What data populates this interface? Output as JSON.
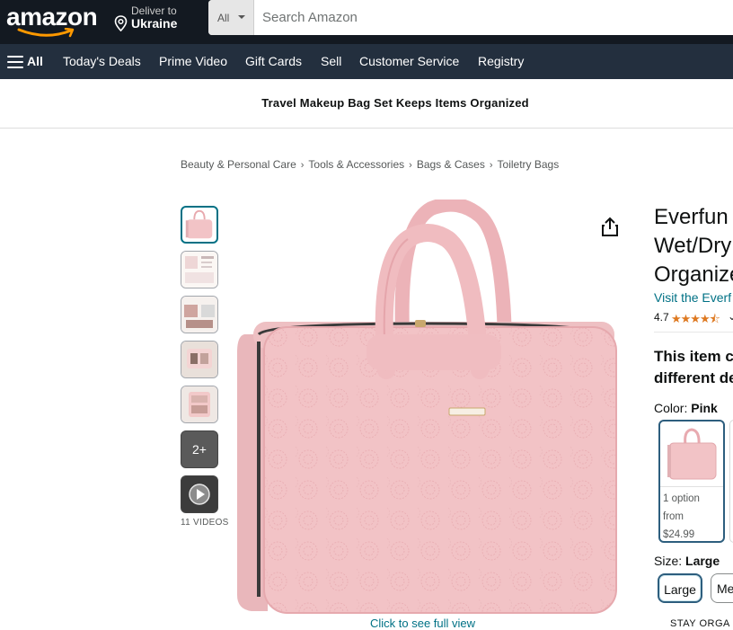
{
  "header": {
    "logo_text": "amazon",
    "deliver_line1": "Deliver to",
    "deliver_line2": "Ukraine",
    "search_category": "All",
    "search_placeholder": "Search Amazon"
  },
  "nav": {
    "all_label": "All",
    "items": [
      "Today's Deals",
      "Prime Video",
      "Gift Cards",
      "Sell",
      "Customer Service",
      "Registry"
    ]
  },
  "promo": {
    "text": "Travel Makeup Bag Set Keeps Items Organized"
  },
  "breadcrumb": [
    "Beauty & Personal Care",
    "Tools & Accessories",
    "Bags & Cases",
    "Toiletry Bags"
  ],
  "gallery": {
    "more_count": "2+",
    "videos_label": "11 VIDEOS",
    "full_view_link": "Click to see full view"
  },
  "product": {
    "title_lines": [
      "Everfun",
      "Wet/Dry",
      "Organize"
    ],
    "store_link": "Visit the Everf",
    "rating_value": "4.7",
    "rating_stars": 4.7,
    "notice_lines": [
      "This item c",
      "different de"
    ],
    "color_label": "Color:",
    "color_value": "Pink",
    "swatch_text_1": "1 option",
    "swatch_text_2": "from",
    "swatch_price": "$24.99",
    "size_label": "Size:",
    "size_value": "Large",
    "size_options": [
      "Large",
      "Me"
    ],
    "partial_text": "STAY ORGA"
  },
  "colors": {
    "header_bg": "#131921",
    "nav_bg": "#232f3e",
    "link": "#007185",
    "star": "#de7921",
    "bag_pink": "#f2c3c6"
  }
}
